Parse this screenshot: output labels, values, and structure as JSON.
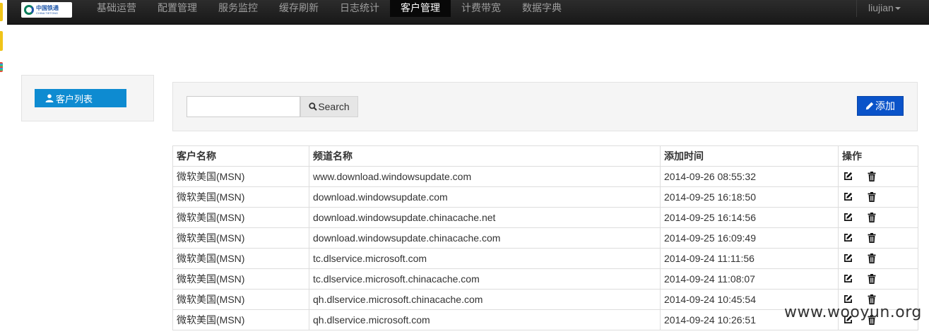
{
  "logo": {
    "name_cn": "中国铁通",
    "name_en": "CHINA TIETONG"
  },
  "navbar": {
    "items": [
      {
        "label": "基础运营",
        "active": false
      },
      {
        "label": "配置管理",
        "active": false
      },
      {
        "label": "服务监控",
        "active": false
      },
      {
        "label": "缓存刷新",
        "active": false
      },
      {
        "label": "日志统计",
        "active": false
      },
      {
        "label": "客户管理",
        "active": true
      },
      {
        "label": "计费带宽",
        "active": false
      },
      {
        "label": "数据字典",
        "active": false
      }
    ],
    "user": "liujian"
  },
  "sidebar": {
    "customer_list_label": "客户列表"
  },
  "search": {
    "value": "",
    "button_label": "Search"
  },
  "toolbar": {
    "add_label": "添加"
  },
  "table": {
    "headers": [
      "客户名称",
      "频道名称",
      "添加时间",
      "操作"
    ],
    "rows": [
      {
        "customer": "微软美国(MSN)",
        "channel": "www.download.windowsupdate.com",
        "time": "2014-09-26 08:55:32"
      },
      {
        "customer": "微软美国(MSN)",
        "channel": "download.windowsupdate.com",
        "time": "2014-09-25 16:18:50"
      },
      {
        "customer": "微软美国(MSN)",
        "channel": "download.windowsupdate.chinacache.net",
        "time": "2014-09-25 16:14:56"
      },
      {
        "customer": "微软美国(MSN)",
        "channel": "download.windowsupdate.chinacache.com",
        "time": "2014-09-25 16:09:49"
      },
      {
        "customer": "微软美国(MSN)",
        "channel": "tc.dlservice.microsoft.com",
        "time": "2014-09-24 11:11:56"
      },
      {
        "customer": "微软美国(MSN)",
        "channel": "tc.dlservice.microsoft.chinacache.com",
        "time": "2014-09-24 11:08:07"
      },
      {
        "customer": "微软美国(MSN)",
        "channel": "qh.dlservice.microsoft.chinacache.com",
        "time": "2014-09-24 10:45:54"
      },
      {
        "customer": "微软美国(MSN)",
        "channel": "qh.dlservice.microsoft.com",
        "time": "2014-09-24 10:26:51"
      }
    ]
  },
  "watermark": "www.wooyun.org",
  "icons": {
    "user": "user-icon",
    "search": "search-icon",
    "add": "pencil-icon",
    "edit": "edit-icon",
    "delete": "trash-icon"
  },
  "colors": {
    "navbar": "#222222",
    "nav_active": "#080808",
    "sidebar_button": "#0e8bd1",
    "add_button": "#0a53c9"
  }
}
